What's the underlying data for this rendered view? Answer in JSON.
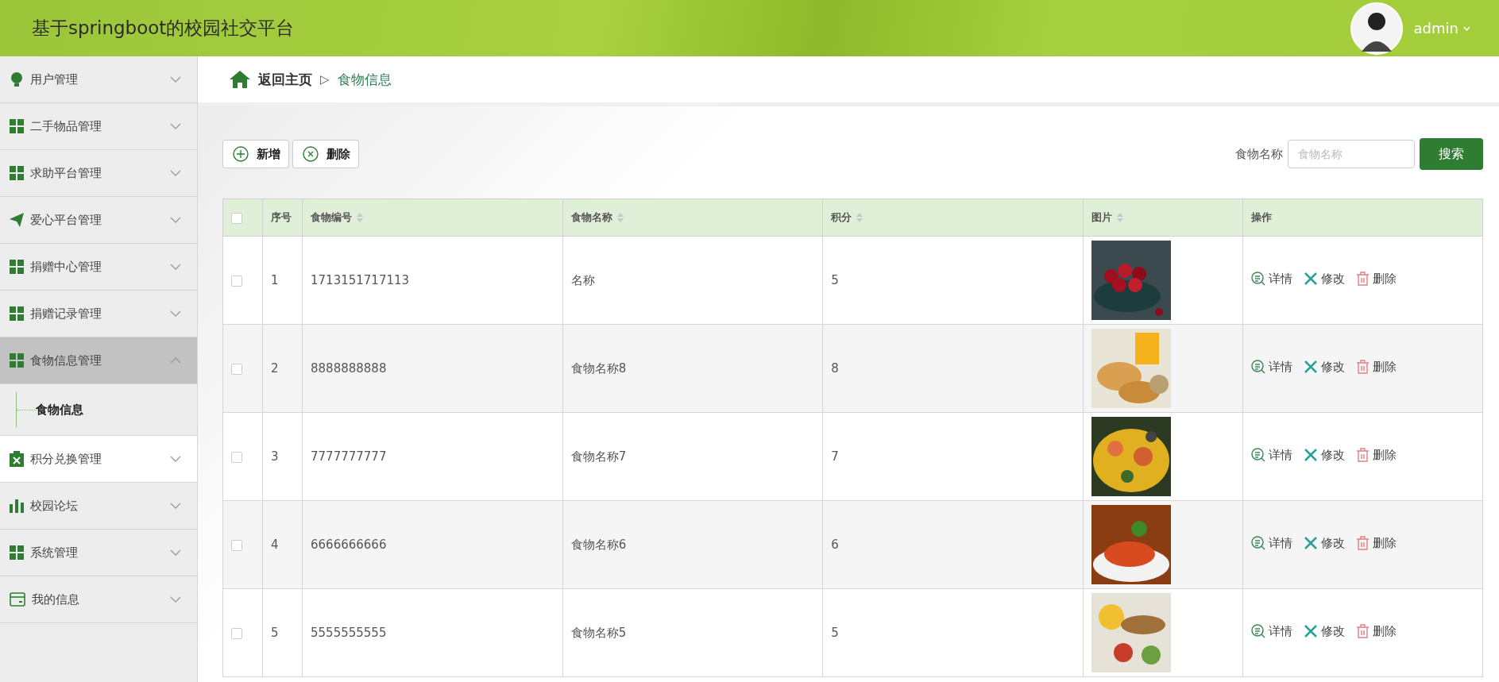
{
  "header": {
    "title": "基于springboot的校园社交平台",
    "user": "admin"
  },
  "sidebar": {
    "items": [
      {
        "label": "用户管理",
        "kind": "bulb",
        "expanded": false,
        "hovered": false
      },
      {
        "label": "二手物品管理",
        "kind": "grid",
        "expanded": false,
        "hovered": false
      },
      {
        "label": "求助平台管理",
        "kind": "grid",
        "expanded": false,
        "hovered": false
      },
      {
        "label": "爱心平台管理",
        "kind": "plane",
        "expanded": false,
        "hovered": false
      },
      {
        "label": "捐赠中心管理",
        "kind": "grid",
        "expanded": false,
        "hovered": false
      },
      {
        "label": "捐赠记录管理",
        "kind": "grid",
        "expanded": false,
        "hovered": false
      },
      {
        "label": "食物信息管理",
        "kind": "grid",
        "expanded": true,
        "hovered": false,
        "children": [
          {
            "label": "食物信息"
          }
        ]
      },
      {
        "label": "积分兑换管理",
        "kind": "clipboard",
        "expanded": false,
        "hovered": true
      },
      {
        "label": "校园论坛",
        "kind": "bars",
        "expanded": false,
        "hovered": false
      },
      {
        "label": "系统管理",
        "kind": "grid",
        "expanded": false,
        "hovered": false
      },
      {
        "label": "我的信息",
        "kind": "wallet",
        "expanded": false,
        "hovered": false
      }
    ]
  },
  "breadcrumb": {
    "home": "返回主页",
    "separator": "▷",
    "current": "食物信息"
  },
  "toolbar": {
    "add": "新增",
    "delete": "删除",
    "search_label": "食物名称",
    "search_placeholder": "食物名称",
    "search_button": "搜索"
  },
  "table": {
    "select_all_checked": false,
    "columns": [
      {
        "label": "序号",
        "sortable": false
      },
      {
        "label": "食物编号",
        "sortable": true
      },
      {
        "label": "食物名称",
        "sortable": true
      },
      {
        "label": "积分",
        "sortable": true
      },
      {
        "label": "图片",
        "sortable": true
      },
      {
        "label": "操作",
        "sortable": false
      }
    ],
    "rows": [
      {
        "checked": false,
        "index": "1",
        "code": "1713151717113",
        "name": "名称",
        "points": "5",
        "actions": [
          "详情",
          "修改",
          "删除"
        ]
      },
      {
        "checked": false,
        "index": "2",
        "code": "8888888888",
        "name": "食物名称8",
        "points": "8",
        "actions": [
          "详情",
          "修改",
          "删除"
        ]
      },
      {
        "checked": false,
        "index": "3",
        "code": "7777777777",
        "name": "食物名称7",
        "points": "7",
        "actions": [
          "详情",
          "修改",
          "删除"
        ]
      },
      {
        "checked": false,
        "index": "4",
        "code": "6666666666",
        "name": "食物名称6",
        "points": "6",
        "actions": [
          "详情",
          "修改",
          "删除"
        ]
      },
      {
        "checked": false,
        "index": "5",
        "code": "5555555555",
        "name": "食物名称5",
        "points": "5",
        "actions": [
          "详情",
          "修改",
          "删除"
        ]
      }
    ]
  }
}
